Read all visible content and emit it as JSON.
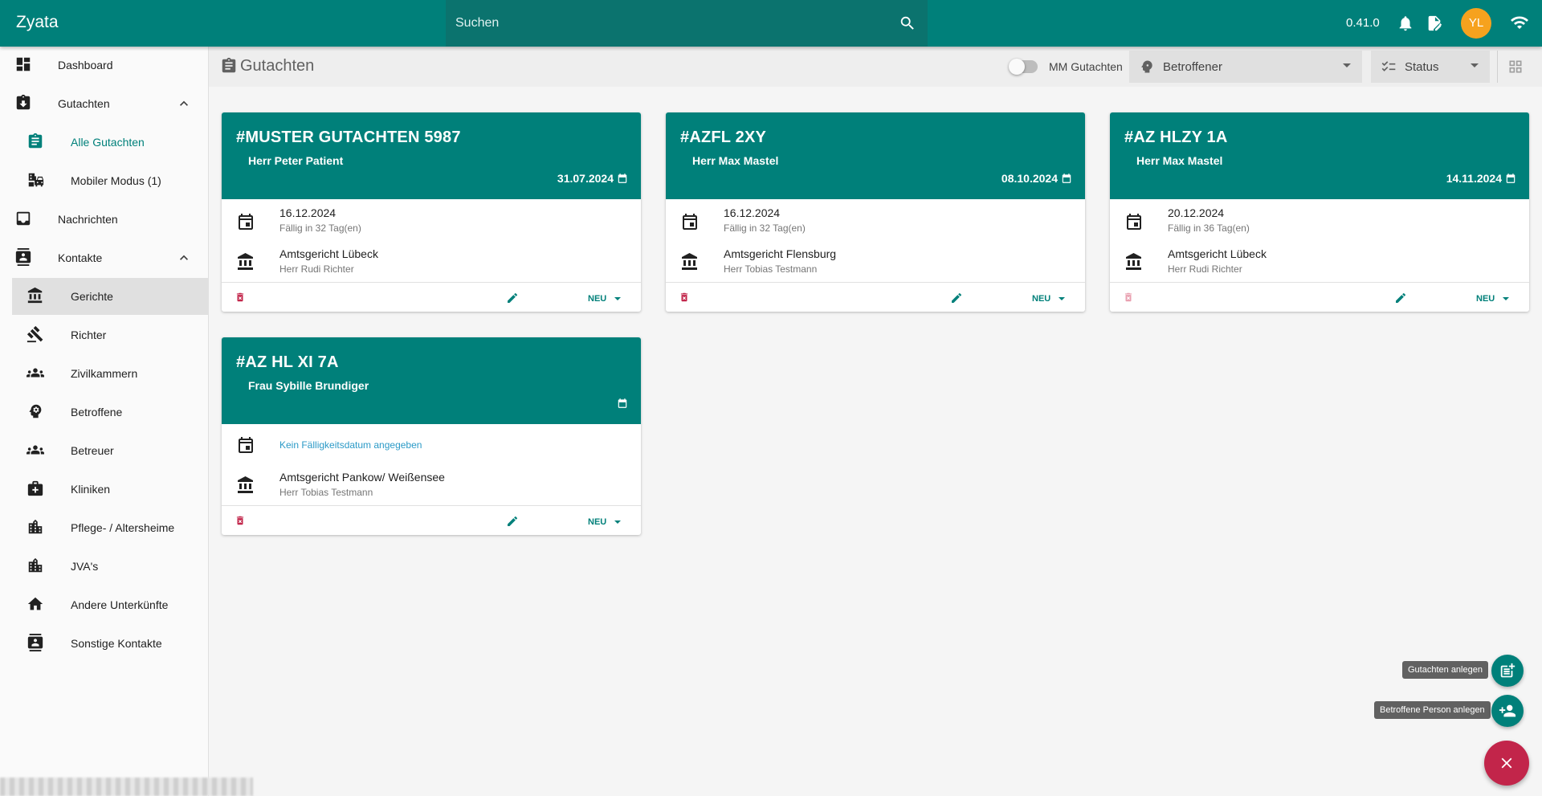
{
  "app": {
    "title": "Zyata",
    "version": "0.41.0",
    "user_initials": "YL"
  },
  "search": {
    "placeholder": "Suchen"
  },
  "sidebar": {
    "items": [
      {
        "label": "Dashboard",
        "icon": "dashboard-icon"
      },
      {
        "label": "Gutachten",
        "icon": "gutachten-icon",
        "expanded": true
      },
      {
        "label": "Alle Gutachten",
        "icon": "clipboard-icon",
        "current": true
      },
      {
        "label": "Mobiler Modus (1)",
        "icon": "mobile-mode-icon"
      },
      {
        "label": "Nachrichten",
        "icon": "inbox-icon"
      },
      {
        "label": "Kontakte",
        "icon": "contacts-icon",
        "expanded": true
      },
      {
        "label": "Gerichte",
        "icon": "court-icon",
        "active": true
      },
      {
        "label": "Richter",
        "icon": "gavel-icon"
      },
      {
        "label": "Zivilkammern",
        "icon": "group-icon"
      },
      {
        "label": "Betroffene",
        "icon": "head-icon"
      },
      {
        "label": "Betreuer",
        "icon": "group-icon"
      },
      {
        "label": "Kliniken",
        "icon": "medical-icon"
      },
      {
        "label": "Pflege- / Altersheime",
        "icon": "building-icon"
      },
      {
        "label": "JVA's",
        "icon": "building-icon"
      },
      {
        "label": "Andere Unterkünfte",
        "icon": "home-icon"
      },
      {
        "label": "Sonstige Kontakte",
        "icon": "contacts-icon"
      }
    ]
  },
  "header": {
    "title": "Gutachten",
    "mm_toggle_label": "MM Gutachten",
    "betroffener_label": "Betroffener",
    "status_label": "Status"
  },
  "cards": [
    {
      "title": "MUSTER GUTACHTEN 5987",
      "person": "Herr Peter Patient",
      "date": "31.07.2024",
      "due_date": "16.12.2024",
      "due_text": "Fällig in 32 Tag(en)",
      "court": "Amtsgericht Lübeck",
      "judge": "Herr Rudi Richter",
      "status": "NEU"
    },
    {
      "title": "AZFL 2XY",
      "person": "Herr Max Mastel",
      "date": "08.10.2024",
      "due_date": "16.12.2024",
      "due_text": "Fällig in 32 Tag(en)",
      "court": "Amtsgericht Flensburg",
      "judge": "Herr Tobias Testmann",
      "status": "NEU"
    },
    {
      "title": "AZ HLZY 1A",
      "person": "Herr Max Mastel",
      "date": "14.11.2024",
      "due_date": "20.12.2024",
      "due_text": "Fällig in 36 Tag(en)",
      "court": "Amtsgericht Lübeck",
      "judge": "Herr Rudi Richter",
      "status": "NEU"
    },
    {
      "title": "AZ HL XI 7A",
      "person": "Frau Sybille Brundiger",
      "date": "",
      "due_empty": "Kein Fälligkeitsdatum angegeben",
      "court": "Amtsgericht Pankow/ Weißensee",
      "judge": "Herr Tobias Testmann",
      "status": "NEU"
    }
  ],
  "fab": {
    "create_gutachten": "Gutachten anlegen",
    "create_person": "Betroffene Person anlegen"
  },
  "colors": {
    "primary": "#00807a",
    "accent": "#f6a21e",
    "danger": "#c2254a"
  }
}
